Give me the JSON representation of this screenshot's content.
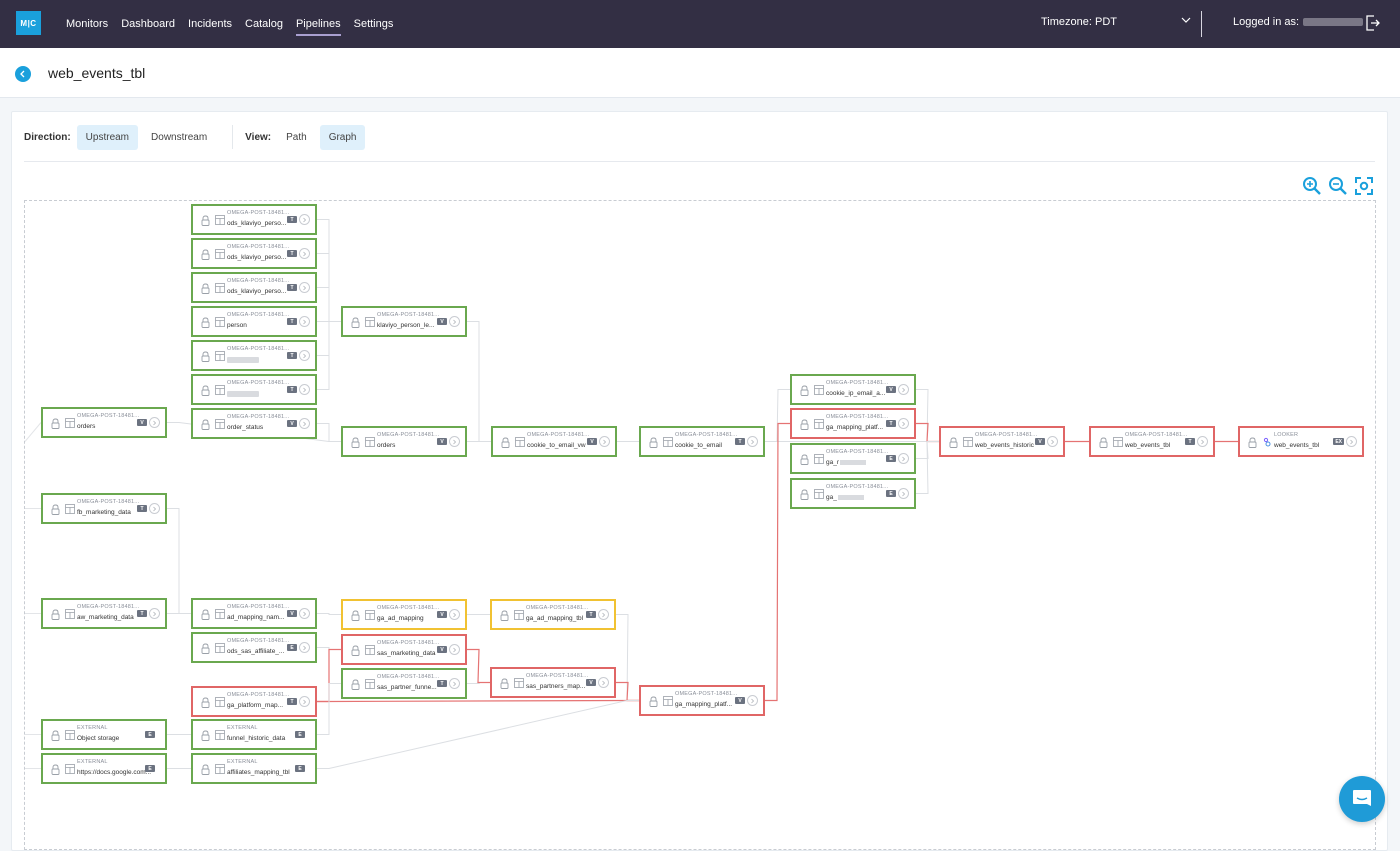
{
  "topbar": {
    "logo": "M|C",
    "nav": [
      {
        "label": "Monitors",
        "active": false
      },
      {
        "label": "Dashboard",
        "active": false
      },
      {
        "label": "Incidents",
        "active": false
      },
      {
        "label": "Catalog",
        "active": false
      },
      {
        "label": "Pipelines",
        "active": true
      },
      {
        "label": "Settings",
        "active": false
      }
    ],
    "timezone": "Timezone: PDT",
    "logged_in_label": "Logged in as:"
  },
  "header": {
    "title": "web_events_tbl"
  },
  "controls": {
    "direction_label": "Direction:",
    "direction_options": [
      "Upstream",
      "Downstream"
    ],
    "direction_selected": "Upstream",
    "view_label": "View:",
    "view_options": [
      "Path",
      "Graph"
    ],
    "view_selected": "Graph"
  },
  "colors": {
    "healthy": "#6aa84f",
    "incident": "#e06666",
    "warning": "#f1c232",
    "accent": "#1aa0dc",
    "topbar": "#332f44"
  },
  "graph": {
    "nodes": [
      {
        "id": "n1",
        "source": "OMEGA-POST-18481...",
        "name": "ods_klaviyo_perso...",
        "badge": "T",
        "status": "healthy"
      },
      {
        "id": "n2",
        "source": "OMEGA-POST-18481...",
        "name": "ods_klaviyo_perso...",
        "badge": "T",
        "status": "healthy"
      },
      {
        "id": "n3",
        "source": "OMEGA-POST-18481...",
        "name": "ods_klaviyo_perso...",
        "badge": "T",
        "status": "healthy"
      },
      {
        "id": "n4",
        "source": "OMEGA-POST-18481...",
        "name": "person",
        "badge": "T",
        "status": "healthy"
      },
      {
        "id": "n5",
        "source": "OMEGA-POST-18481...",
        "name": "",
        "blurred": true,
        "badge": "T",
        "status": "healthy"
      },
      {
        "id": "n6",
        "source": "OMEGA-POST-18481...",
        "name": "",
        "blurred": true,
        "badge": "T",
        "status": "healthy"
      },
      {
        "id": "n7",
        "source": "OMEGA-POST-18481...",
        "name": "order_status",
        "badge": "V",
        "status": "healthy"
      },
      {
        "id": "n8",
        "source": "OMEGA-POST-18481...",
        "name": "orders",
        "badge": "V",
        "status": "healthy"
      },
      {
        "id": "n9",
        "source": "OMEGA-POST-18481...",
        "name": "klaviyo_person_le...",
        "badge": "V",
        "status": "healthy"
      },
      {
        "id": "n10",
        "source": "OMEGA-POST-18481...",
        "name": "orders",
        "badge": "V",
        "status": "healthy"
      },
      {
        "id": "n11",
        "source": "OMEGA-POST-18481...",
        "name": "cookie_to_email_vw",
        "badge": "V",
        "status": "healthy"
      },
      {
        "id": "n12",
        "source": "OMEGA-POST-18481...",
        "name": "cookie_to_email",
        "badge": "T",
        "status": "healthy"
      },
      {
        "id": "n13",
        "source": "OMEGA-POST-18481...",
        "name": "cookie_ip_email_a...",
        "badge": "V",
        "status": "healthy"
      },
      {
        "id": "n14",
        "source": "OMEGA-POST-18481...",
        "name": "ga_mapping_platf...",
        "badge": "T",
        "status": "incident"
      },
      {
        "id": "n15",
        "source": "OMEGA-POST-18481...",
        "name": "ga_r",
        "blurred_suffix": true,
        "badge": "E",
        "status": "healthy"
      },
      {
        "id": "n16",
        "source": "OMEGA-POST-18481...",
        "name": "ga_",
        "blurred_suffix": true,
        "badge": "E",
        "status": "healthy"
      },
      {
        "id": "n17",
        "source": "OMEGA-POST-18481...",
        "name": "web_events_historic",
        "badge": "V",
        "status": "incident"
      },
      {
        "id": "n18",
        "source": "OMEGA-POST-18481...",
        "name": "web_events_tbl",
        "badge": "T",
        "status": "incident"
      },
      {
        "id": "n19",
        "source": "LOOKER",
        "name": "web_events_tbl",
        "badge": "EX",
        "status": "incident",
        "kind": "looker"
      },
      {
        "id": "n20",
        "source": "OMEGA-POST-18481...",
        "name": "fb_marketing_data",
        "badge": "T",
        "status": "healthy"
      },
      {
        "id": "n21",
        "source": "OMEGA-POST-18481...",
        "name": "aw_marketing_data",
        "badge": "T",
        "status": "healthy"
      },
      {
        "id": "n22",
        "source": "OMEGA-POST-18481...",
        "name": "ad_mapping_nam...",
        "badge": "V",
        "status": "healthy"
      },
      {
        "id": "n23",
        "source": "OMEGA-POST-18481...",
        "name": "ods_sas_affiliate_...",
        "badge": "E",
        "status": "healthy"
      },
      {
        "id": "n24",
        "source": "OMEGA-POST-18481...",
        "name": "ga_platform_map...",
        "badge": "T",
        "status": "incident"
      },
      {
        "id": "n25",
        "source": "OMEGA-POST-18481...",
        "name": "ga_ad_mapping",
        "badge": "V",
        "status": "warning"
      },
      {
        "id": "n26",
        "source": "OMEGA-POST-18481...",
        "name": "sas_marketing_data",
        "badge": "V",
        "status": "incident"
      },
      {
        "id": "n27",
        "source": "OMEGA-POST-18481...",
        "name": "sas_partner_funne...",
        "badge": "T",
        "status": "healthy"
      },
      {
        "id": "n28",
        "source": "OMEGA-POST-18481...",
        "name": "ga_ad_mapping_tbl",
        "badge": "T",
        "status": "warning"
      },
      {
        "id": "n29",
        "source": "OMEGA-POST-18481...",
        "name": "sas_partners_map...",
        "badge": "V",
        "status": "incident"
      },
      {
        "id": "n30",
        "source": "OMEGA-POST-18481...",
        "name": "ga_mapping_platf...",
        "badge": "V",
        "status": "incident"
      },
      {
        "id": "n31",
        "source": "EXTERNAL",
        "name": "Object storage",
        "badge": "E",
        "status": "healthy",
        "kind": "external"
      },
      {
        "id": "n32",
        "source": "EXTERNAL",
        "name": "https://docs.google.com...",
        "badge": "E",
        "status": "healthy",
        "kind": "external"
      },
      {
        "id": "n33",
        "source": "EXTERNAL",
        "name": "funnel_historic_data",
        "badge": "E",
        "status": "healthy",
        "kind": "external"
      },
      {
        "id": "n34",
        "source": "EXTERNAL",
        "name": "affiliates_mapping_tbl",
        "badge": "E",
        "status": "healthy",
        "kind": "external"
      }
    ],
    "edges": [
      [
        "n1",
        "n9",
        false
      ],
      [
        "n2",
        "n9",
        false
      ],
      [
        "n3",
        "n9",
        false
      ],
      [
        "n4",
        "n9",
        false
      ],
      [
        "n5",
        "n9",
        false
      ],
      [
        "n6",
        "n9",
        false
      ],
      [
        "n7",
        "n10",
        false
      ],
      [
        "n8",
        "n10",
        false
      ],
      [
        "n9",
        "n11",
        false
      ],
      [
        "n10",
        "n11",
        false
      ],
      [
        "n11",
        "n12",
        false
      ],
      [
        "n12",
        "n13",
        false
      ],
      [
        "n12",
        "n17",
        false
      ],
      [
        "n13",
        "n17",
        false
      ],
      [
        "n14",
        "n17",
        true
      ],
      [
        "n15",
        "n17",
        false
      ],
      [
        "n16",
        "n17",
        false
      ],
      [
        "n17",
        "n18",
        true
      ],
      [
        "n18",
        "n19",
        true
      ],
      [
        "n20",
        "n22",
        false
      ],
      [
        "n21",
        "n22",
        false
      ],
      [
        "n22",
        "n25",
        false
      ],
      [
        "n23",
        "n26",
        false
      ],
      [
        "n24",
        "n26",
        true
      ],
      [
        "n24",
        "n30",
        true
      ],
      [
        "n27",
        "n29",
        false
      ],
      [
        "n26",
        "n29",
        true
      ],
      [
        "n25",
        "n28",
        false
      ],
      [
        "n28",
        "n30",
        false
      ],
      [
        "n29",
        "n30",
        true
      ],
      [
        "n30",
        "n14",
        true
      ],
      [
        "n31",
        "n33",
        false
      ],
      [
        "n32",
        "n34",
        false
      ],
      [
        "n34",
        "n30",
        false
      ],
      [
        "n33",
        "n27",
        false
      ]
    ]
  },
  "icons": {
    "zoom_in": "zoom-in-icon",
    "zoom_out": "zoom-out-icon",
    "fit": "fit-view-icon",
    "chat": "chat-icon"
  }
}
